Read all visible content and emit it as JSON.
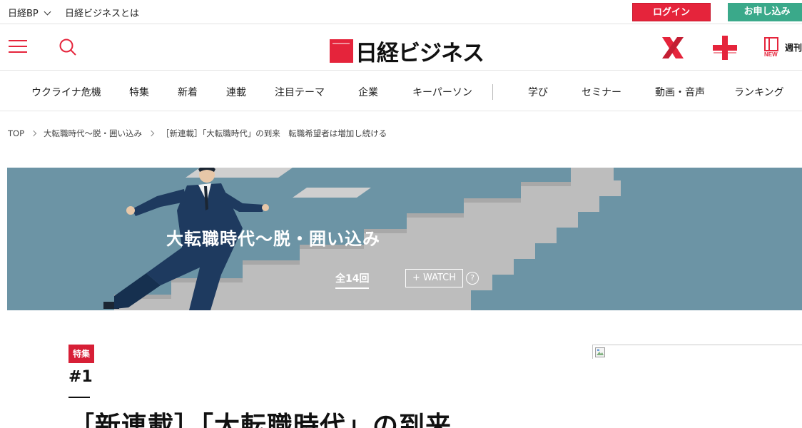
{
  "topbar": {
    "site_switch": "日経BP",
    "about": "日経ビジネスとは",
    "login": "ログイン",
    "signup": "お申し込み"
  },
  "header": {
    "logo_text": "日経ビジネス",
    "weekly_label": "週刊"
  },
  "nav": [
    "ウクライナ危機",
    "特集",
    "新着",
    "連載",
    "注目テーマ",
    "企業",
    "キーパーソン",
    "学び",
    "セミナー",
    "動画・音声",
    "ランキング"
  ],
  "breadcrumb": [
    "TOP",
    "大転職時代〜脱・囲い込み",
    "［新連載］「大転職時代」の到来　転職希望者は増加し続ける"
  ],
  "hero": {
    "series_title": "大転職時代〜脱・囲い込み",
    "episode_count": "全14回",
    "watch_label": "+ WATCH",
    "help": "?"
  },
  "article": {
    "badge": "特集",
    "episode": "#1",
    "headline": "［新連載］「大転職時代」の到来"
  },
  "colors": {
    "brand_red": "#e5243b",
    "signup_green": "#3aa98a",
    "hero_blue": "#6c94a5"
  }
}
